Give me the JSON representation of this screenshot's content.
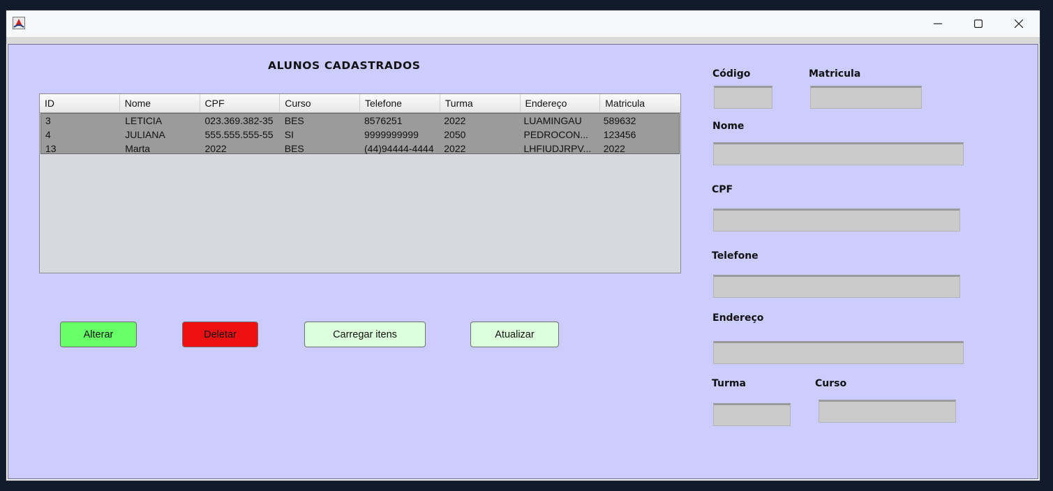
{
  "window": {
    "controls": {
      "minimize": "—",
      "maximize": "☐",
      "close": "✕"
    }
  },
  "page": {
    "title": "ALUNOS CADASTRADOS"
  },
  "table": {
    "columns": [
      "ID",
      "Nome",
      "CPF",
      "Curso",
      "Telefone",
      "Turma",
      "Endereço",
      "Matricula"
    ],
    "rows": [
      [
        "3",
        "LETICIA",
        "023.369.382-35",
        "BES",
        "8576251",
        "2022",
        "LUAMINGAU",
        "589632"
      ],
      [
        "4",
        "JULIANA",
        "555.555.555-55",
        "SI",
        "9999999999",
        "2050",
        "PEDROCON...",
        "123456"
      ],
      [
        "13",
        "Marta",
        "2022",
        "BES",
        "(44)94444-4444",
        "2022",
        "LHFIUDJRPV...",
        "2022"
      ]
    ]
  },
  "buttons": {
    "alterar": "Alterar",
    "deletar": "Deletar",
    "carregar": "Carregar itens",
    "atualizar": "Atualizar"
  },
  "form": {
    "codigo_label": "Código",
    "matricula_label": "Matricula",
    "nome_label": "Nome",
    "cpf_label": "CPF",
    "telefone_label": "Telefone",
    "endereco_label": "Endereço",
    "turma_label": "Turma",
    "curso_label": "Curso",
    "codigo_value": "",
    "matricula_value": "",
    "nome_value": "",
    "cpf_value": "",
    "telefone_value": "",
    "endereco_value": "",
    "turma_value": "",
    "curso_value": ""
  },
  "colors": {
    "background": "#ccccfe",
    "alterar": "#66ff66",
    "deletar": "#ee1111",
    "neutral_button": "#dcffdc",
    "selected_rows": "#9b9b9b"
  }
}
